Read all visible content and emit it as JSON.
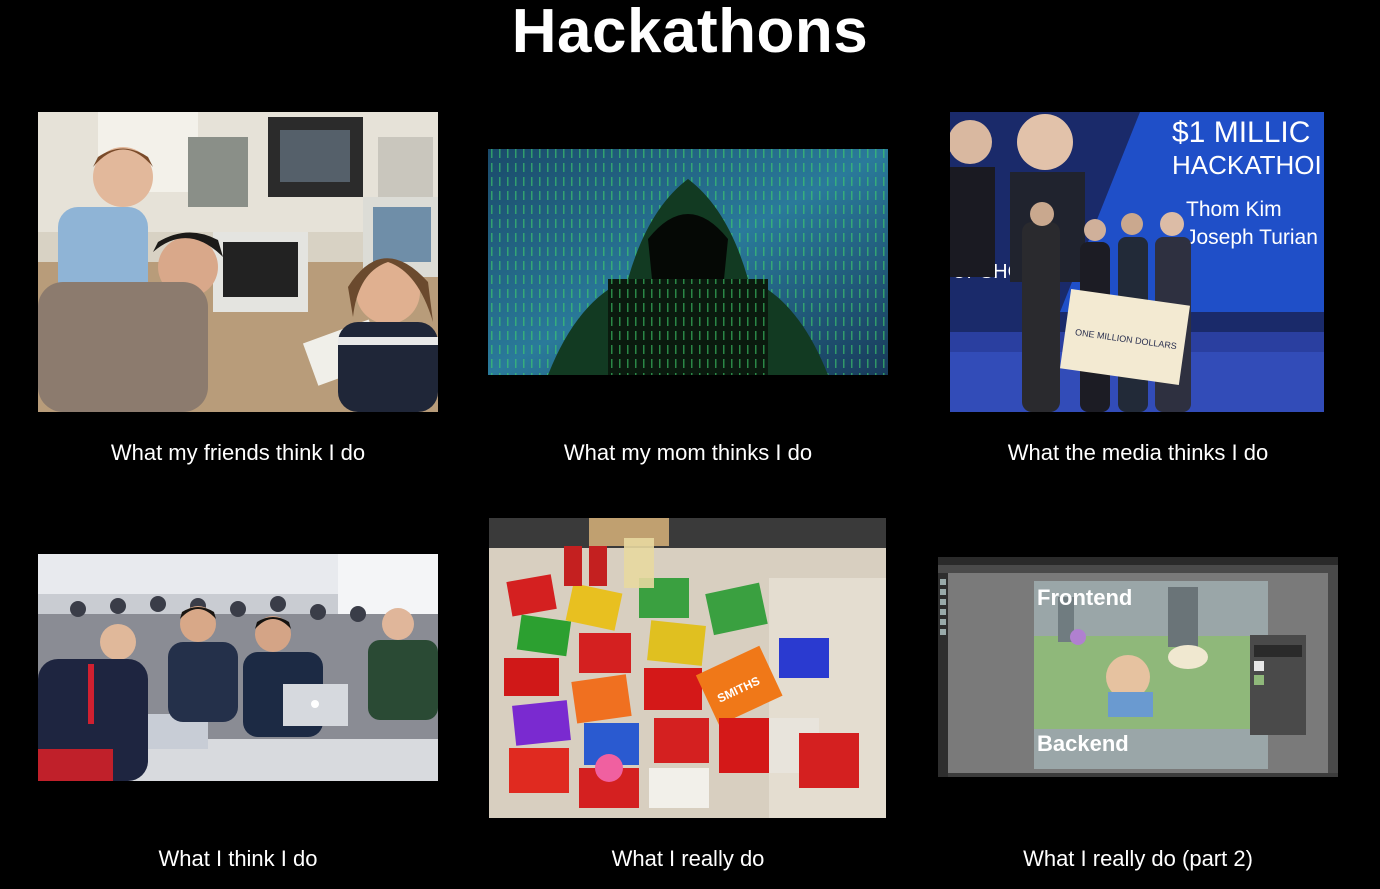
{
  "meme": {
    "title": "Hackathons",
    "panels": [
      {
        "caption": "What my friends think I do",
        "image_icon": "people-with-computers-photo"
      },
      {
        "caption": "What my mom thinks I do",
        "image_icon": "hooded-hacker-photo"
      },
      {
        "caption": "What the media thinks I do",
        "image_icon": "award-ceremony-photo"
      },
      {
        "caption": "What I think I do",
        "image_icon": "hackathon-room-photo"
      },
      {
        "caption": "What I really do",
        "image_icon": "snacks-table-photo"
      },
      {
        "caption": "What I really do (part 2)",
        "image_icon": "photo-editor-screenshot"
      }
    ],
    "media_photo": {
      "banner_line1": "$1 MILLIC",
      "banner_line2": "HACKATHOI",
      "name1": "Thom Kim",
      "name2": "Joseph Turian",
      "logo": "UPSHOT",
      "check_text": "ONE MILLION DOLLARS"
    },
    "editor_photo": {
      "label_top": "Frontend",
      "label_bottom": "Backend"
    },
    "snacks_photo": {
      "chip_brand": "SMITHS"
    },
    "colors": {
      "background": "#000000",
      "text": "#ffffff"
    }
  }
}
